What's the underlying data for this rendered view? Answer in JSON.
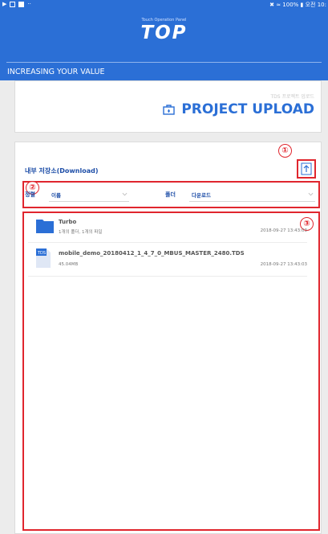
{
  "status_bar": {
    "left_icons": [
      "play-icon",
      "gallery-icon",
      "video-icon",
      "more-icon"
    ],
    "right_text": "✖ ≈ 100% ▮ 오전 10:"
  },
  "header": {
    "brand_small": "Touch Operation Panel",
    "brand": "TOP",
    "tagline": "INCREASING YOUR VALUE"
  },
  "upload_card": {
    "subtitle": "TDS 프로젝트 업로드",
    "title": "PROJECT UPLOAD"
  },
  "panel": {
    "storage_label": "내부 저장소(Download)",
    "markers": [
      "①",
      "②",
      "③"
    ],
    "filters": {
      "sort_label": "정렬",
      "sort_value": "이름",
      "folder_label": "폴더",
      "folder_value": "다운로드"
    },
    "files": [
      {
        "name": "Turbo",
        "sub": "1개의 폴더, 1개의 파일",
        "date": "2018-09-27 13:43:03",
        "icon": "folder-icon"
      },
      {
        "name": "mobile_demo_20180412_1_4_7_0_MBUS_MASTER_2480.TDS",
        "sub": "45.04MB",
        "date": "2018-09-27 13:43:03",
        "icon": "tds-file-icon",
        "icon_text": "TDS"
      }
    ]
  },
  "colors": {
    "brand_blue": "#2b6fd6",
    "annotation_red": "#e0262e",
    "label_blue": "#1f4fa8"
  }
}
